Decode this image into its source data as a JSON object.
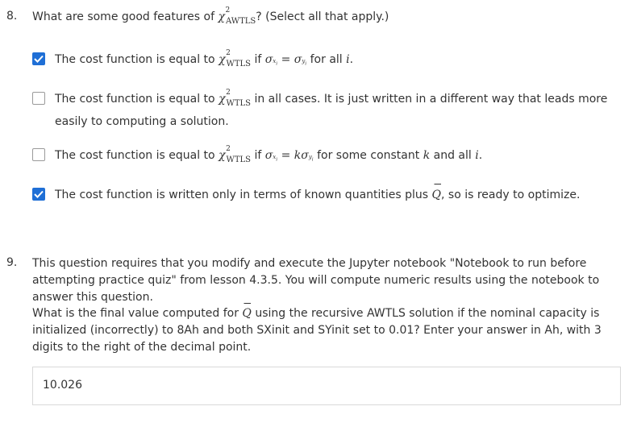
{
  "q8": {
    "number": "8.",
    "prompt_before": "What are some good features of",
    "prompt_chi_sub": "AWTLS",
    "prompt_after": "? (Select all that apply.)",
    "options": [
      {
        "checked": true,
        "text_a": "The cost function is equal to",
        "chi_sub": "WTLS",
        "text_b": "if",
        "math": "σ = σ",
        "text_c": "for all",
        "var": "i",
        "text_d": "."
      },
      {
        "checked": false,
        "text_a": "The cost function is equal to",
        "chi_sub": "WTLS",
        "text_b": "in all cases. It is just written in a different way that leads more easily to computing a solution."
      },
      {
        "checked": false,
        "text_a": "The cost function is equal to",
        "chi_sub": "WTLS",
        "text_b": "if",
        "text_c": "for some constant",
        "var_k": "k",
        "text_d": "and all",
        "var_i": "i",
        "text_e": "."
      },
      {
        "checked": true,
        "text_a": "The cost function is written only in terms of known quantities plus",
        "qhat": "Q",
        "text_b": ", so is ready to optimize."
      }
    ]
  },
  "q9": {
    "number": "9.",
    "paragraph1": "This question requires that you modify and execute the Jupyter notebook \"Notebook to run before attempting practice quiz\" from lesson 4.3.5. You will compute numeric results using the notebook to answer this question.",
    "p2_before": "What is the final value computed for",
    "p2_qhat": "Q",
    "p2_after": "using the recursive AWTLS solution if the nominal capacity is initialized (incorrectly) to 8Ah and both SXinit and SYinit set to 0.01? Enter your answer in Ah, with 3 digits to the right of the decimal point.",
    "answer_value": "10.026"
  },
  "colors": {
    "accent": "#1f6fd6",
    "text": "#333333",
    "border": "#d9d9d9"
  }
}
